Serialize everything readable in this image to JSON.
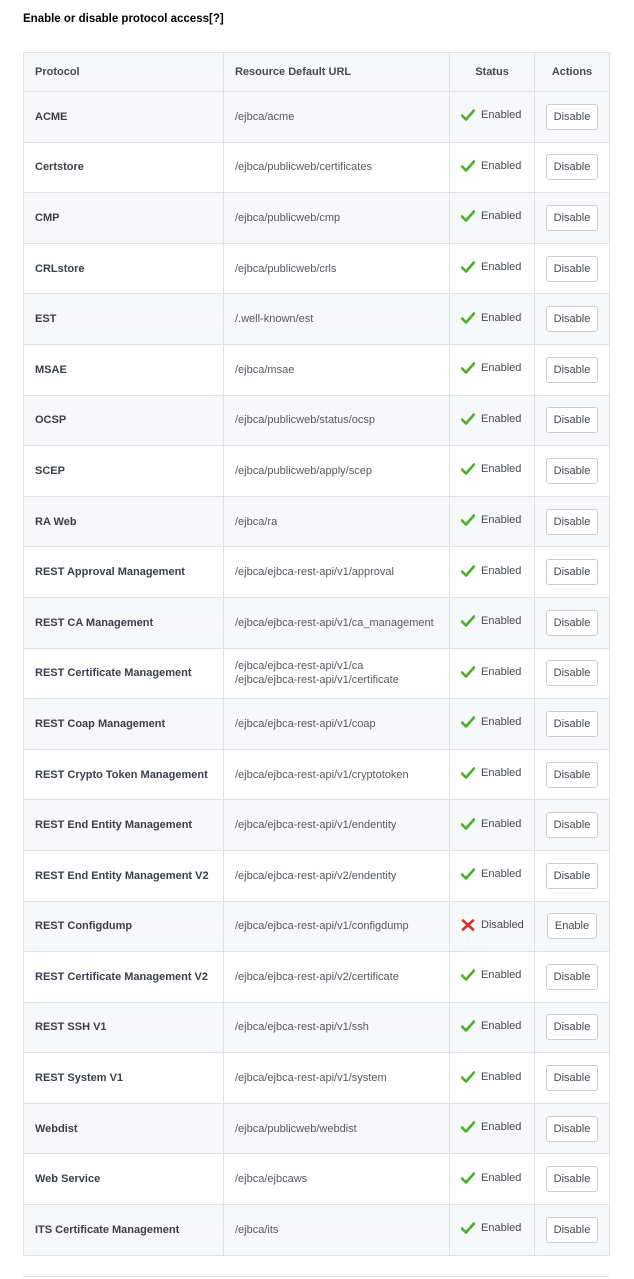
{
  "page": {
    "title": "Enable or disable protocol access",
    "help_link": "[?]"
  },
  "table": {
    "headers": {
      "protocol": "Protocol",
      "url": "Resource Default URL",
      "status": "Status",
      "actions": "Actions"
    },
    "rows": [
      {
        "protocol": "ACME",
        "urls": [
          "/ejbca/acme"
        ],
        "status": "Enabled",
        "enabled": true,
        "action": "Disable"
      },
      {
        "protocol": "Certstore",
        "urls": [
          "/ejbca/publicweb/certificates"
        ],
        "status": "Enabled",
        "enabled": true,
        "action": "Disable"
      },
      {
        "protocol": "CMP",
        "urls": [
          "/ejbca/publicweb/cmp"
        ],
        "status": "Enabled",
        "enabled": true,
        "action": "Disable"
      },
      {
        "protocol": "CRLstore",
        "urls": [
          "/ejbca/publicweb/crls"
        ],
        "status": "Enabled",
        "enabled": true,
        "action": "Disable"
      },
      {
        "protocol": "EST",
        "urls": [
          "/.well-known/est"
        ],
        "status": "Enabled",
        "enabled": true,
        "action": "Disable"
      },
      {
        "protocol": "MSAE",
        "urls": [
          "/ejbca/msae"
        ],
        "status": "Enabled",
        "enabled": true,
        "action": "Disable"
      },
      {
        "protocol": "OCSP",
        "urls": [
          "/ejbca/publicweb/status/ocsp"
        ],
        "status": "Enabled",
        "enabled": true,
        "action": "Disable"
      },
      {
        "protocol": "SCEP",
        "urls": [
          "/ejbca/publicweb/apply/scep"
        ],
        "status": "Enabled",
        "enabled": true,
        "action": "Disable"
      },
      {
        "protocol": "RA Web",
        "urls": [
          "/ejbca/ra"
        ],
        "status": "Enabled",
        "enabled": true,
        "action": "Disable"
      },
      {
        "protocol": "REST Approval Management",
        "urls": [
          "/ejbca/ejbca-rest-api/v1/approval"
        ],
        "status": "Enabled",
        "enabled": true,
        "action": "Disable"
      },
      {
        "protocol": "REST CA Management",
        "urls": [
          "/ejbca/ejbca-rest-api/v1/ca_management"
        ],
        "status": "Enabled",
        "enabled": true,
        "action": "Disable"
      },
      {
        "protocol": "REST Certificate Management",
        "urls": [
          "/ejbca/ejbca-rest-api/v1/ca",
          "/ejbca/ejbca-rest-api/v1/certificate"
        ],
        "status": "Enabled",
        "enabled": true,
        "action": "Disable"
      },
      {
        "protocol": "REST Coap Management",
        "urls": [
          "/ejbca/ejbca-rest-api/v1/coap"
        ],
        "status": "Enabled",
        "enabled": true,
        "action": "Disable"
      },
      {
        "protocol": "REST Crypto Token Management",
        "urls": [
          "/ejbca/ejbca-rest-api/v1/cryptotoken"
        ],
        "status": "Enabled",
        "enabled": true,
        "action": "Disable"
      },
      {
        "protocol": "REST End Entity Management",
        "urls": [
          "/ejbca/ejbca-rest-api/v1/endentity"
        ],
        "status": "Enabled",
        "enabled": true,
        "action": "Disable"
      },
      {
        "protocol": "REST End Entity Management V2",
        "urls": [
          "/ejbca/ejbca-rest-api/v2/endentity"
        ],
        "status": "Enabled",
        "enabled": true,
        "action": "Disable"
      },
      {
        "protocol": "REST Configdump",
        "urls": [
          "/ejbca/ejbca-rest-api/v1/configdump"
        ],
        "status": "Disabled",
        "enabled": false,
        "action": "Enable"
      },
      {
        "protocol": "REST Certificate Management V2",
        "urls": [
          "/ejbca/ejbca-rest-api/v2/certificate"
        ],
        "status": "Enabled",
        "enabled": true,
        "action": "Disable"
      },
      {
        "protocol": "REST SSH V1",
        "urls": [
          "/ejbca/ejbca-rest-api/v1/ssh"
        ],
        "status": "Enabled",
        "enabled": true,
        "action": "Disable"
      },
      {
        "protocol": "REST System V1",
        "urls": [
          "/ejbca/ejbca-rest-api/v1/system"
        ],
        "status": "Enabled",
        "enabled": true,
        "action": "Disable"
      },
      {
        "protocol": "Webdist",
        "urls": [
          "/ejbca/publicweb/webdist"
        ],
        "status": "Enabled",
        "enabled": true,
        "action": "Disable"
      },
      {
        "protocol": "Web Service",
        "urls": [
          "/ejbca/ejbcaws"
        ],
        "status": "Enabled",
        "enabled": true,
        "action": "Disable"
      },
      {
        "protocol": "ITS Certificate Management",
        "urls": [
          "/ejbca/its"
        ],
        "status": "Enabled",
        "enabled": true,
        "action": "Disable"
      }
    ]
  },
  "icons": {
    "enabled": "check-icon",
    "disabled": "cross-icon"
  },
  "colors": {
    "enabled_icon": "#4caf2a",
    "disabled_icon": "#d9302c"
  }
}
